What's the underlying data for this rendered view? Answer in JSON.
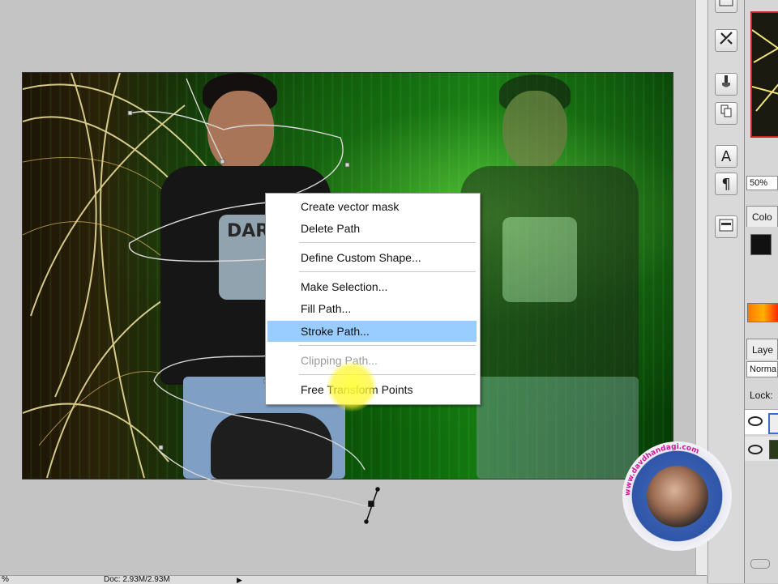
{
  "context_menu": {
    "items": [
      {
        "label": "Create vector mask",
        "state": "normal"
      },
      {
        "label": "Delete Path",
        "state": "normal"
      },
      {
        "label": "Define Custom Shape...",
        "state": "normal"
      },
      {
        "label": "Make Selection...",
        "state": "normal"
      },
      {
        "label": "Fill Path...",
        "state": "normal"
      },
      {
        "label": "Stroke Path...",
        "state": "highlighted"
      },
      {
        "label": "Clipping Path...",
        "state": "disabled"
      },
      {
        "label": "Free Transform Points",
        "state": "normal"
      }
    ]
  },
  "shirt_text": "DARE",
  "right_panel": {
    "zoom": "50%",
    "color_tab": "Colo",
    "layers_tab": "Laye",
    "blend_mode": "Norma",
    "lock_label": "Lock:"
  },
  "tool_icons": [
    "panel-icon",
    "tools-icon",
    "brush-icon",
    "clone-stamp-icon",
    "character-icon",
    "paragraph-icon",
    "layer-comps-icon"
  ],
  "tool_glyphs": {
    "character": "A",
    "paragraph": "¶"
  },
  "status_bar": {
    "left": "%",
    "doc": "Doc: 2.93M/2.93M"
  },
  "watermark": {
    "text": "www.davdhandagi.com"
  },
  "colors": {
    "menu_highlight": "#99ccff",
    "workspace": "#c4c4c4",
    "selection_glow": "#ffff33"
  }
}
